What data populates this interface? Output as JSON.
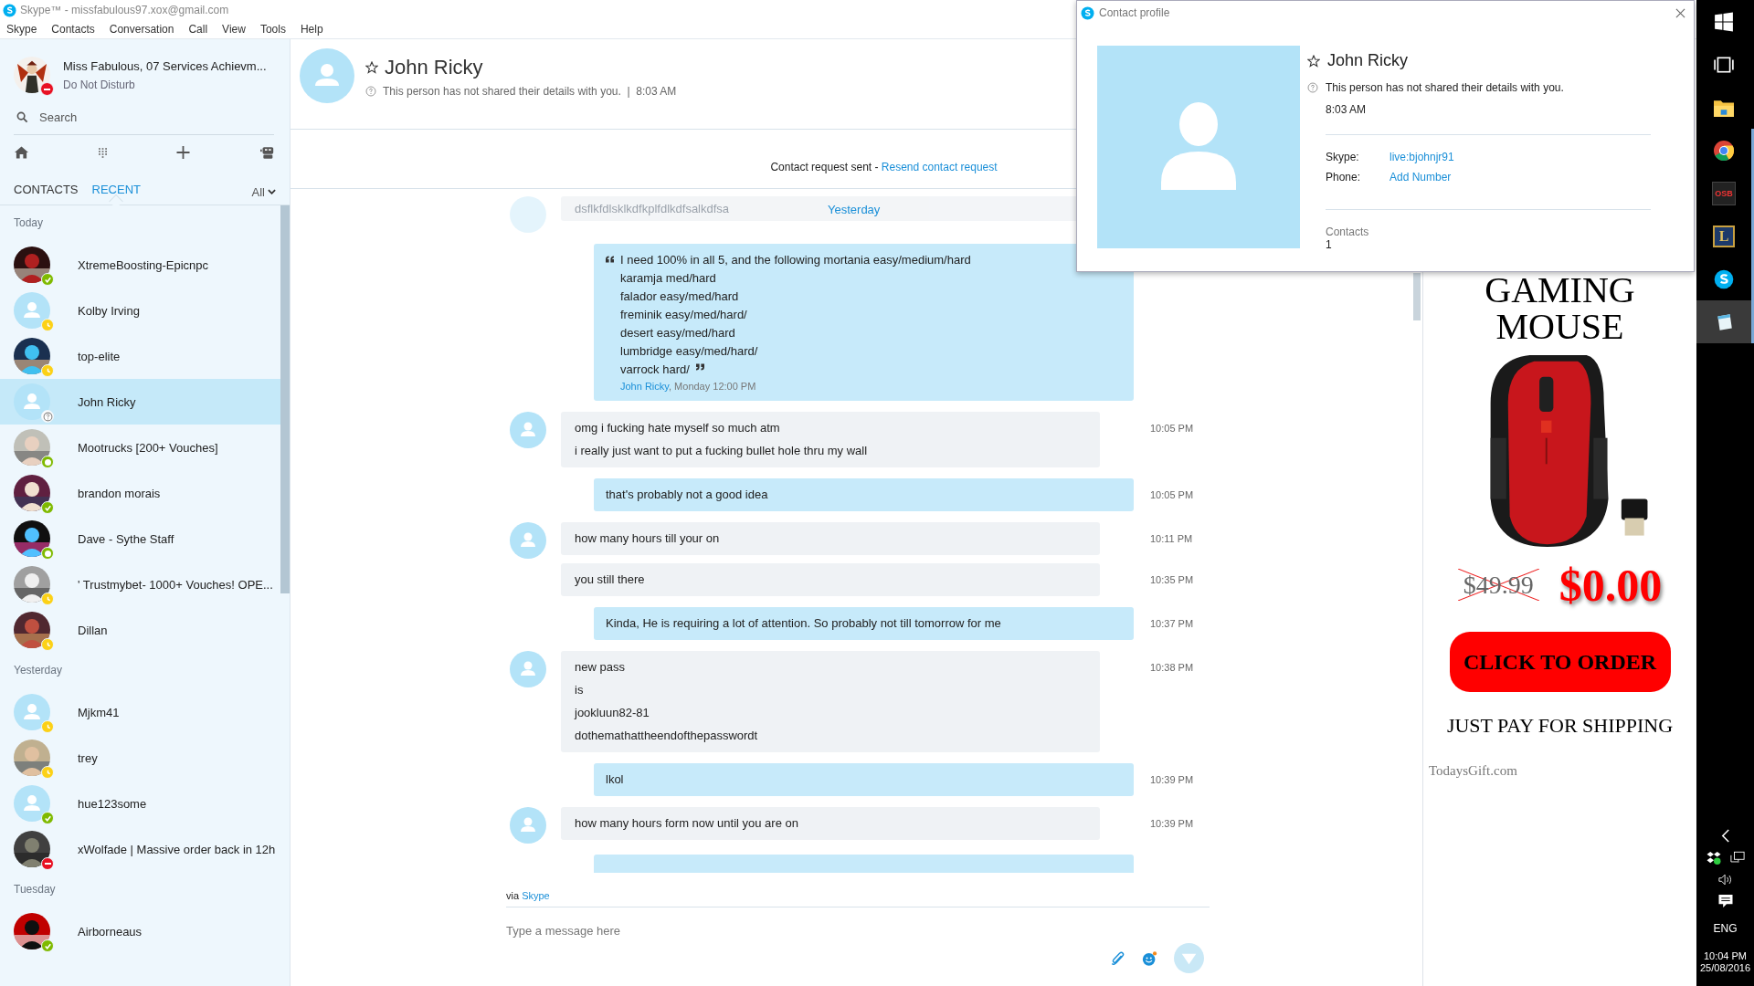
{
  "window": {
    "title": "Skype™ - missfabulous97.xox@gmail.com"
  },
  "menu": [
    "Skype",
    "Contacts",
    "Conversation",
    "Call",
    "View",
    "Tools",
    "Help"
  ],
  "profile": {
    "name": "Miss Fabulous, 07 Services Achievm...",
    "status_text": "Do Not Disturb",
    "badge": {
      "kind": "dash",
      "color": "#e81123"
    }
  },
  "search": {
    "placeholder": "Search"
  },
  "tabs": [
    {
      "label": "CONTACTS",
      "selected": false
    },
    {
      "label": "RECENT",
      "selected": true
    }
  ],
  "filter": {
    "label": "All"
  },
  "groups": [
    {
      "label": "Today",
      "items": [
        {
          "name": "XtremeBoosting-Epicnpc",
          "kind": "picture",
          "badge": {
            "kind": "check",
            "color": "#7fba00"
          },
          "selected": false
        },
        {
          "name": "Kolby Irving",
          "kind": "default",
          "badge": {
            "kind": "clock",
            "color": "#fcd116"
          },
          "selected": false
        },
        {
          "name": "top-elite",
          "kind": "picture",
          "badge": {
            "kind": "clock",
            "color": "#fcd116"
          },
          "selected": false
        },
        {
          "name": "John Ricky",
          "kind": "default",
          "badge": {
            "kind": "question",
            "color": "#ffffff"
          },
          "selected": true
        },
        {
          "name": "Mootrucks [200+ Vouches]",
          "kind": "picture",
          "badge": {
            "kind": "ring",
            "color": "#7fba00"
          },
          "selected": false
        },
        {
          "name": "brandon morais",
          "kind": "picture",
          "badge": {
            "kind": "check",
            "color": "#7fba00"
          },
          "selected": false
        },
        {
          "name": "Dave - Sythe Staff",
          "kind": "picture",
          "badge": {
            "kind": "ring",
            "color": "#7fba00"
          },
          "selected": false
        },
        {
          "name": "' Trustmybet- 1000+ Vouches! OPE...",
          "kind": "picture",
          "badge": {
            "kind": "clock",
            "color": "#fcd116"
          },
          "selected": false
        },
        {
          "name": "Dillan",
          "kind": "picture",
          "badge": {
            "kind": "clock",
            "color": "#fcd116"
          },
          "selected": false
        }
      ]
    },
    {
      "label": "Yesterday",
      "items": [
        {
          "name": "Mjkm41",
          "kind": "default",
          "badge": {
            "kind": "clock",
            "color": "#fcd116"
          },
          "selected": false
        },
        {
          "name": "trey",
          "kind": "picture",
          "badge": {
            "kind": "clock",
            "color": "#fcd116"
          },
          "selected": false
        },
        {
          "name": "hue123some",
          "kind": "default",
          "badge": {
            "kind": "check",
            "color": "#7fba00"
          },
          "selected": false
        },
        {
          "name": "xWolfade | Massive order back in 12h",
          "kind": "picture",
          "badge": {
            "kind": "dash",
            "color": "#e81123"
          },
          "selected": false
        }
      ]
    },
    {
      "label": "Tuesday",
      "items": [
        {
          "name": "Airborneaus",
          "kind": "picture",
          "badge": {
            "kind": "check",
            "color": "#7fba00"
          },
          "selected": false
        }
      ]
    }
  ],
  "chat": {
    "name": "John Ricky",
    "subtitle": "This person has not shared their details with you.  |  8:03 AM",
    "request": {
      "text": "Contact request sent - ",
      "link": "Resend contact request"
    },
    "day_label": "Yesterday",
    "faded_message": "dsflkfdlsklkdfkplfdlkdfsalkdfsa",
    "messages": [
      {
        "kind": "quote",
        "lines": [
          "I need 100% in all 5, and the following mortania easy/medium/hard",
          "karamja med/hard",
          "falador easy/med/hard",
          "freminik easy/med/hard/",
          "desert easy/med/hard",
          "lumbridge easy/med/hard/",
          "varrock hard/"
        ],
        "author": "John Ricky",
        "author_time": ", Monday 12:00 PM"
      },
      {
        "kind": "incoming",
        "lines": [
          "omg i fucking hate myself so much atm",
          "i really just want to put a fucking bullet hole thru my wall"
        ],
        "time": "10:05 PM",
        "avatar": true
      },
      {
        "kind": "outgoing",
        "lines": [
          "that's probably not a good idea"
        ],
        "time": "10:05 PM"
      },
      {
        "kind": "incoming",
        "lines": [
          "how many hours till your on"
        ],
        "time": "10:11 PM",
        "avatar": true
      },
      {
        "kind": "incoming",
        "lines": [
          "you still there"
        ],
        "time": "10:35 PM",
        "avatar": false
      },
      {
        "kind": "outgoing",
        "lines": [
          "Kinda, He is requiring a lot of attention. So probably not till tomorrow for me"
        ],
        "time": "10:37 PM"
      },
      {
        "kind": "incoming",
        "lines": [
          "new pass",
          "is",
          "jookluun82-81",
          "dothemathattheendofthepasswordt"
        ],
        "time": "10:38 PM",
        "avatar": true
      },
      {
        "kind": "outgoing",
        "lines": [
          "lkol"
        ],
        "time": "10:39 PM"
      },
      {
        "kind": "incoming",
        "lines": [
          "how many hours form now until you are on"
        ],
        "time": "10:39 PM",
        "avatar": true
      },
      {
        "kind": "cut"
      }
    ],
    "via": {
      "text": "via ",
      "link": "Skype"
    },
    "composer": {
      "placeholder": "Type a message here"
    }
  },
  "ad": {
    "title": "GAMING MOUSE",
    "old_price": "$49.99",
    "price": "$0.00",
    "button": "CLICK TO ORDER",
    "tagline": "JUST PAY FOR SHIPPING",
    "source": "TodaysGift.com"
  },
  "contact_profile": {
    "title": "Contact profile",
    "name": "John Ricky",
    "notice": "This person has not shared their details with you.",
    "time": "8:03 AM",
    "fields": [
      {
        "label": "Skype:",
        "value": "live:bjohnjr91"
      },
      {
        "label": "Phone:",
        "value": "Add Number"
      }
    ],
    "contacts_label": "Contacts",
    "contacts_count": "1"
  },
  "taskbar": {
    "apps": [
      {
        "kind": "windows",
        "running": false,
        "active": false
      },
      {
        "kind": "taskview",
        "running": false,
        "active": false
      },
      {
        "kind": "explorer",
        "running": false,
        "active": false
      },
      {
        "kind": "chrome",
        "running": true,
        "active": false
      },
      {
        "kind": "osb",
        "label": "OSB",
        "running": true,
        "active": false
      },
      {
        "kind": "league",
        "label": "L",
        "running": true,
        "active": false
      },
      {
        "kind": "skype",
        "running": true,
        "active": false
      },
      {
        "kind": "notepad",
        "running": true,
        "active": true
      }
    ],
    "language": "ENG",
    "time": "10:04 PM",
    "date": "25/08/2016"
  }
}
